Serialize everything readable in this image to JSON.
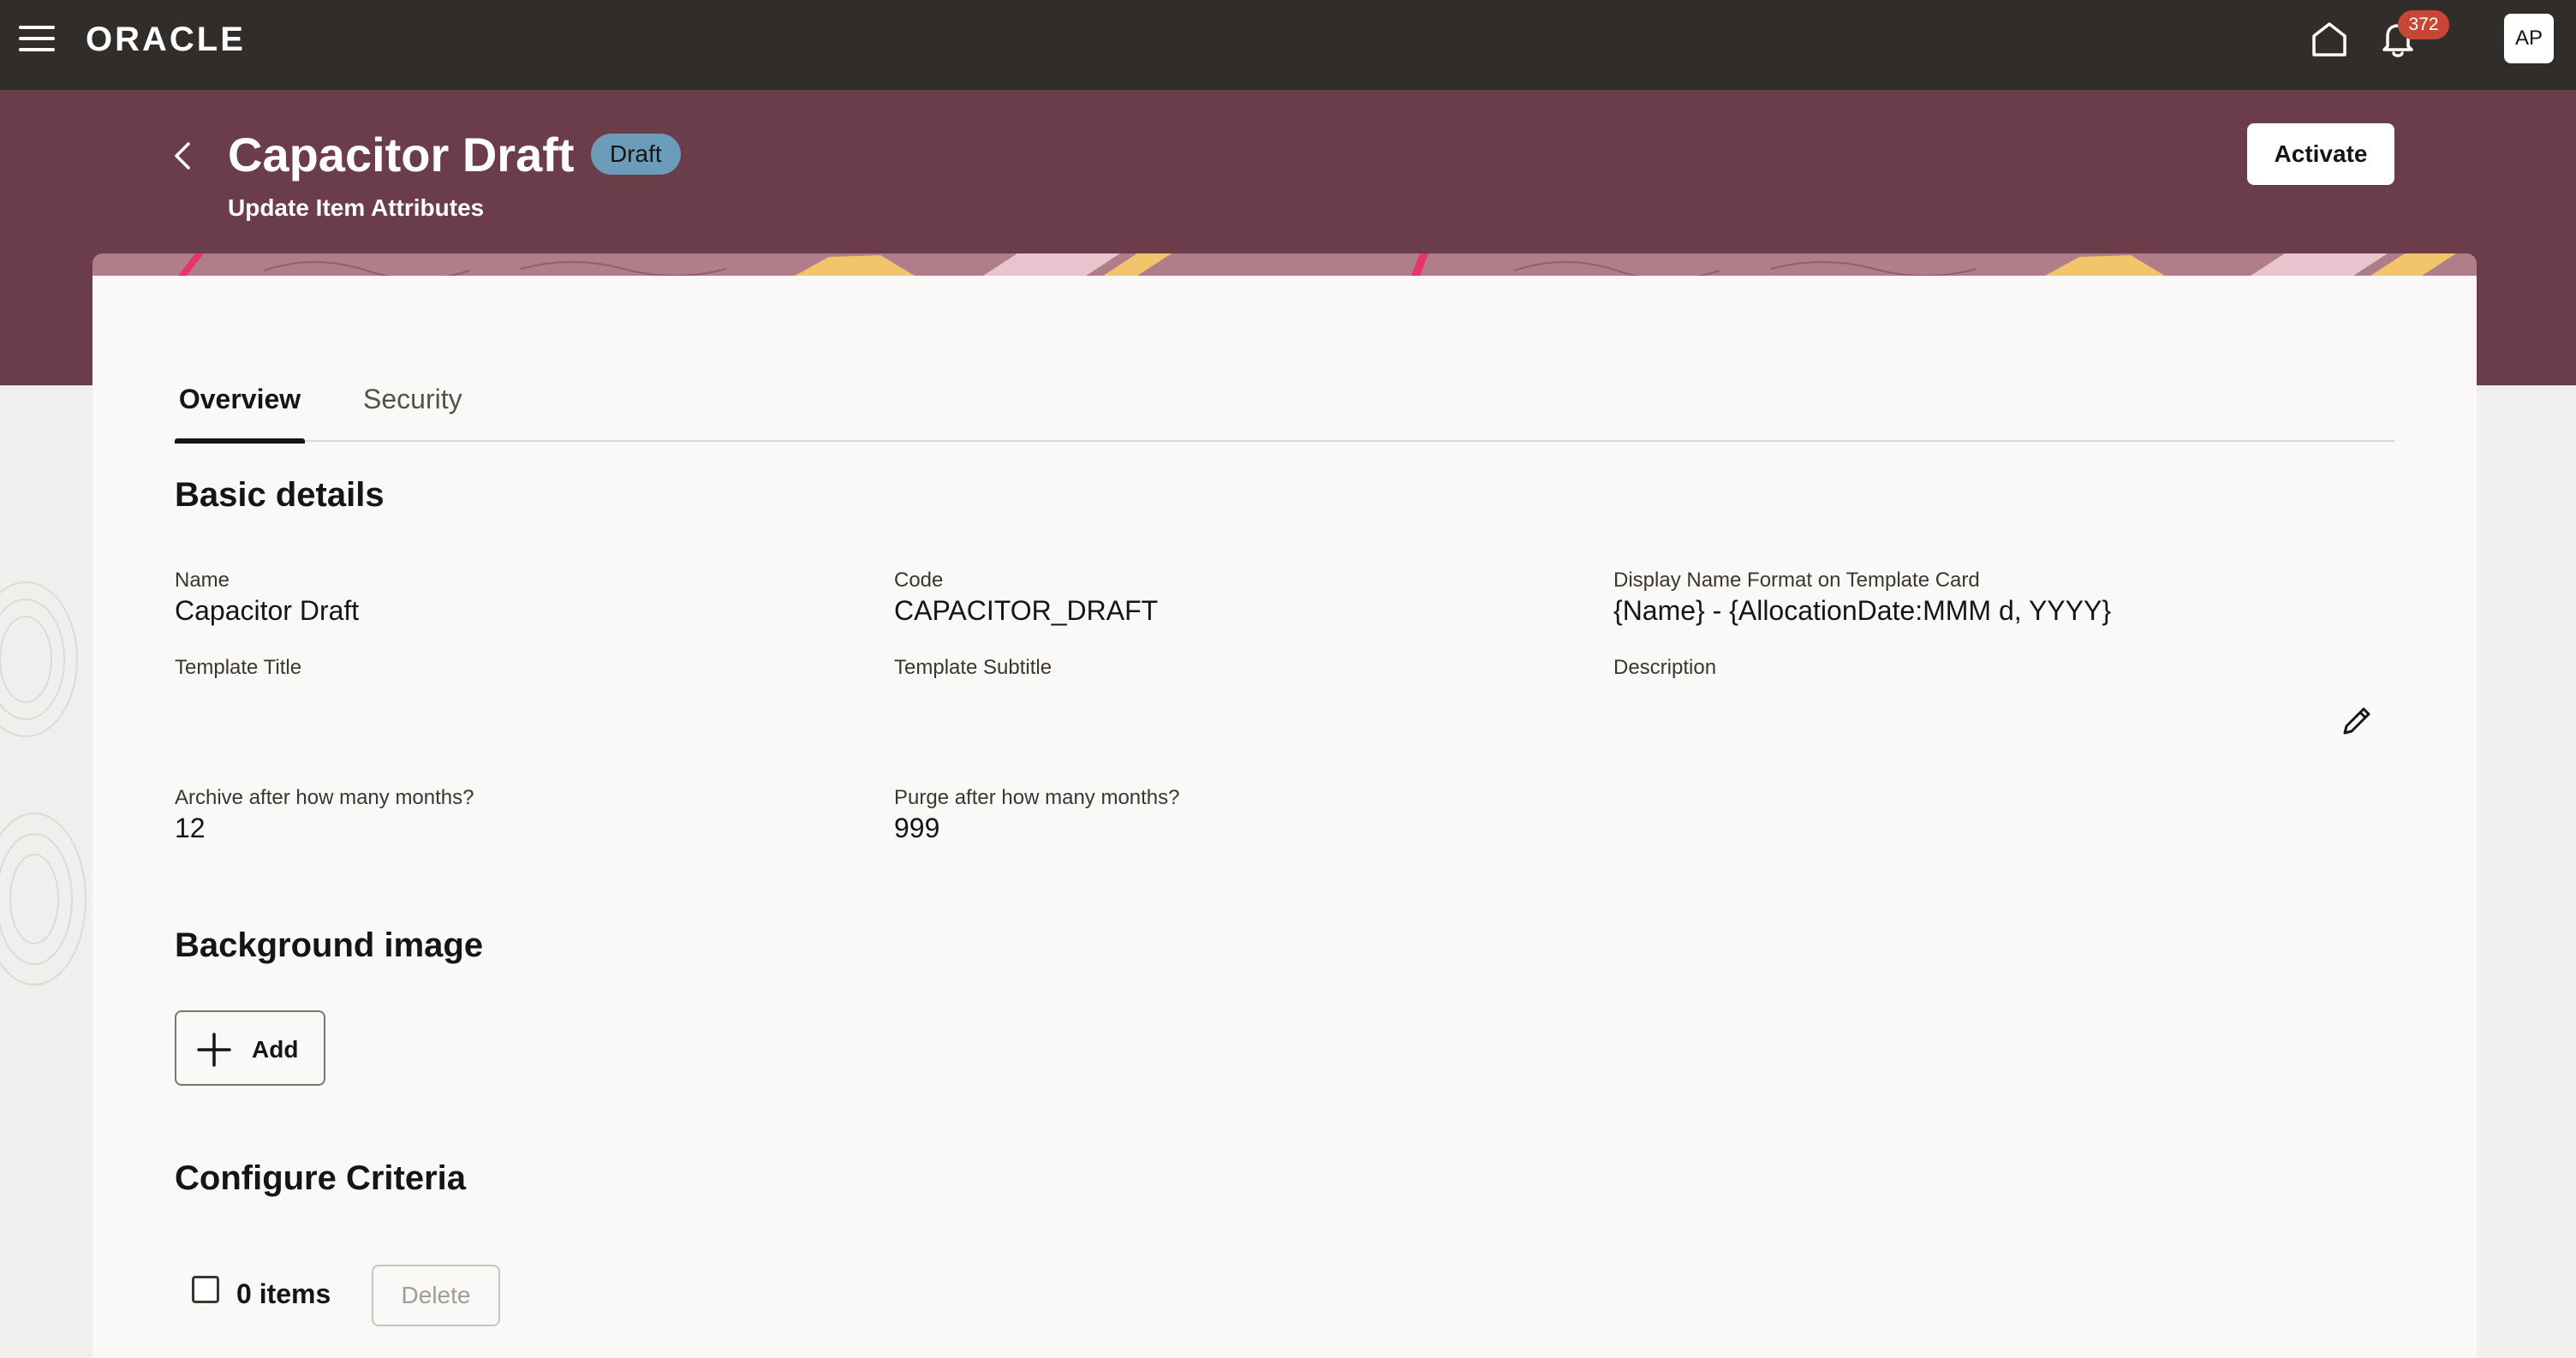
{
  "app": {
    "brand": "ORACLE",
    "notification_count": "372",
    "avatar_initials": "AP"
  },
  "header": {
    "title": "Capacitor Draft",
    "status_badge": "Draft",
    "subtitle": "Update Item Attributes",
    "activate_label": "Activate"
  },
  "tabs": [
    {
      "label": "Overview",
      "active": true
    },
    {
      "label": "Security",
      "active": false
    }
  ],
  "basic_details": {
    "section_title": "Basic details",
    "fields": {
      "name": {
        "label": "Name",
        "value": "Capacitor Draft"
      },
      "code": {
        "label": "Code",
        "value": "CAPACITOR_DRAFT"
      },
      "display_name_format": {
        "label": "Display Name Format on Template Card",
        "value": "{Name} - {AllocationDate:MMM d, YYYY}"
      },
      "template_title": {
        "label": "Template Title",
        "value": ""
      },
      "template_subtitle": {
        "label": "Template Subtitle",
        "value": ""
      },
      "description": {
        "label": "Description",
        "value": ""
      },
      "archive_months": {
        "label": "Archive after how many months?",
        "value": "12"
      },
      "purge_months": {
        "label": "Purge after how many months?",
        "value": "999"
      }
    }
  },
  "background_image": {
    "section_title": "Background image",
    "add_label": "Add"
  },
  "configure_criteria": {
    "section_title": "Configure Criteria",
    "items_count": "0 items",
    "delete_label": "Delete"
  },
  "colors": {
    "topbar": "#312d2a",
    "header": "#6b3d4b",
    "badge": "#6b9dbb",
    "notification": "#c74634"
  }
}
